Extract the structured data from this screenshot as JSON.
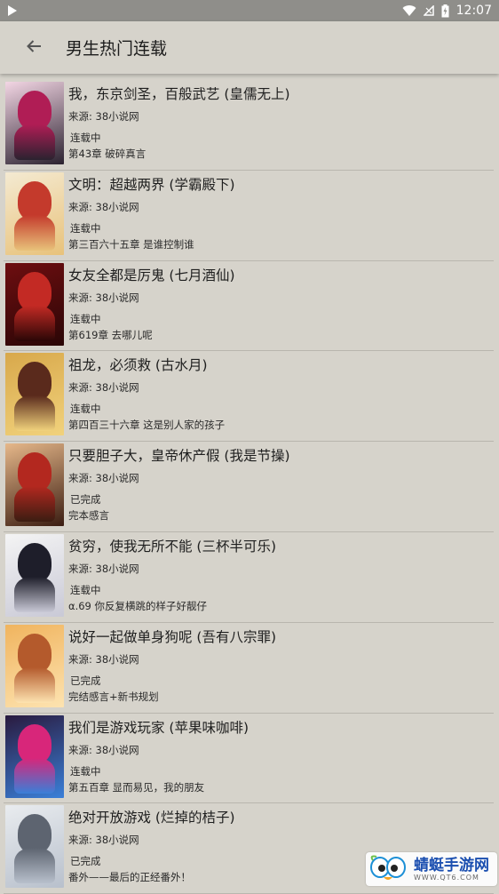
{
  "status_bar": {
    "time": "12:07"
  },
  "app_bar": {
    "title": "男生热门连载"
  },
  "books": [
    {
      "name": "我，东京剑圣，百般武艺 (皇儒无上)",
      "source": "来源: 38小说网",
      "state": "连载中",
      "chapter": "第43章 破碎真言",
      "colors": [
        "#f3d6e4",
        "#b01d55",
        "#2b2230"
      ]
    },
    {
      "name": "文明：超越两界 (学霸殿下)",
      "source": "来源: 38小说网",
      "state": "连载中",
      "chapter": "第三百六十五章 是谁控制谁",
      "colors": [
        "#f4ead2",
        "#c43a2c",
        "#e8c27a"
      ]
    },
    {
      "name": "女友全都是厉鬼 (七月酒仙)",
      "source": "来源: 38小说网",
      "state": "连载中",
      "chapter": "第619章 去哪儿呢",
      "colors": [
        "#6e0e10",
        "#c32a24",
        "#2a0606"
      ]
    },
    {
      "name": "祖龙，必须救 (古水月)",
      "source": "来源: 38小说网",
      "state": "连载中",
      "chapter": "第四百三十六章 这是别人家的孩子",
      "colors": [
        "#d8a84b",
        "#5a2a1c",
        "#f1d27c"
      ]
    },
    {
      "name": "只要胆子大，皇帝休产假 (我是节操)",
      "source": "来源: 38小说网",
      "state": "已完成",
      "chapter": "完本感言",
      "colors": [
        "#e6b88a",
        "#b3281f",
        "#3b1d12"
      ]
    },
    {
      "name": "贫穷，使我无所不能 (三杯半可乐)",
      "source": "来源: 38小说网",
      "state": "连载中",
      "chapter": "α.69 你反复横跳的样子好靓仔",
      "colors": [
        "#f4f4f4",
        "#1e1e2a",
        "#c9c9d6"
      ]
    },
    {
      "name": "说好一起做单身狗呢 (吾有八宗罪)",
      "source": "来源: 38小说网",
      "state": "已完成",
      "chapter": "完结感言+新书规划",
      "colors": [
        "#f0b45e",
        "#b45a2c",
        "#fde3b0"
      ]
    },
    {
      "name": "我们是游戏玩家 (苹果味咖啡)",
      "source": "来源: 38小说网",
      "state": "连载中",
      "chapter": "第五百章 显而易见，我的朋友",
      "colors": [
        "#2a1a3e",
        "#d8267a",
        "#3a7fd8"
      ]
    },
    {
      "name": "绝对开放游戏 (烂掉的桔子)",
      "source": "来源: 38小说网",
      "state": "已完成",
      "chapter": "番外——最后的正经番外！",
      "colors": [
        "#e9ecef",
        "#5d6470",
        "#b8c0cc"
      ]
    }
  ],
  "watermark": {
    "main": "蜻蜓手游网",
    "sub": "WWW.QT6.COM"
  }
}
